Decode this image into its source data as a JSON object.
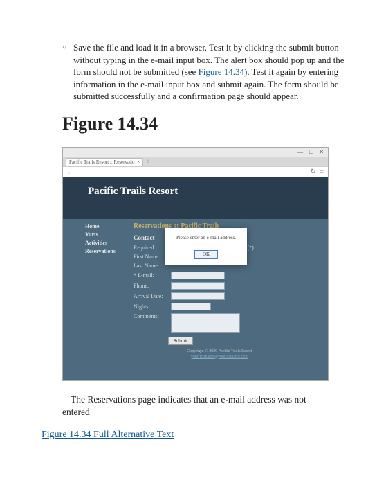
{
  "bullet": {
    "text_before_link": "Save the file and load it in a browser. Test it by clicking the submit button without typing in the e-mail input box. The alert box should pop up and the form should not be submitted (see ",
    "link_label": "Figure 14.34",
    "text_after_link": "). Test it again by entering information in the e-mail input box and submit again. The form should be submitted successfully and a confirmation page should appear."
  },
  "figure_heading": "Figure 14.34",
  "screenshot": {
    "window": {
      "min": "—",
      "max": "☐",
      "close": "✕"
    },
    "tab_label": "Pacific Trails Resort :: Reservatio",
    "tab_close": "×",
    "addr": {
      "back": "←",
      "reload": "↻",
      "menu": "≡"
    },
    "site_title": "Pacific Trails Resort",
    "nav": [
      "Home",
      "Yurts",
      "Activities",
      "Reservations"
    ],
    "section_title": "Reservations at Pacific Trails",
    "contact_header": "Contact",
    "required_left": "Required",
    "required_right": "asterisk (*).",
    "fields": {
      "first": "First Name",
      "last": "Last Name",
      "email": "* E-mail:",
      "phone": "Phone:",
      "arrival": "Arrival Date:",
      "nights": "Nights:",
      "comments": "Comments:"
    },
    "submit_label": "Submit",
    "copyright_line1": "Copyright © 2020 Pacific Trails Resort",
    "copyright_link": "yourfirstname@yourlastname.com",
    "dialog": {
      "message": "Please enter an e-mail address.",
      "ok": "OK"
    }
  },
  "caption": "The Reservations page indicates that an e-mail address was not entered",
  "alt_text_link": "Figure 14.34 Full Alternative Text"
}
